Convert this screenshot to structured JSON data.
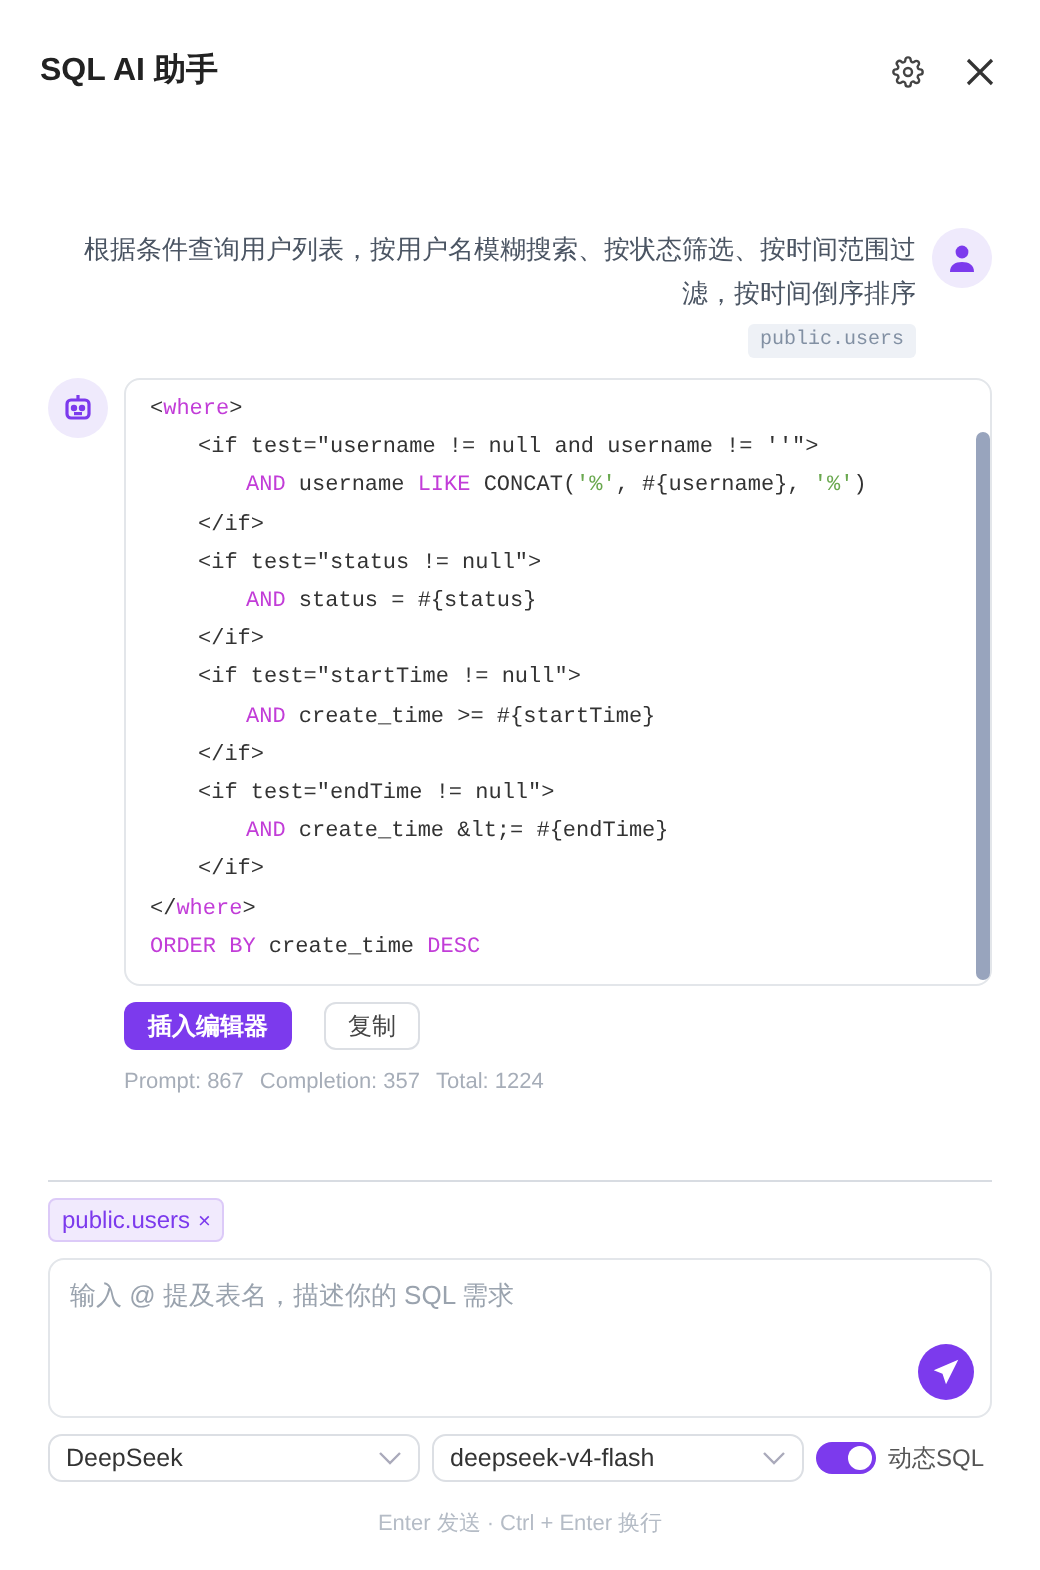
{
  "header": {
    "title": "SQL AI 助手"
  },
  "user_message": {
    "text": "根据条件查询用户列表，按用户名模糊搜索、按状态筛选、按时间范围过滤，按时间倒序排序",
    "table_tag": "public.users"
  },
  "assistant_message": {
    "code_lines": [
      {
        "tokens": [
          {
            "kind": "plain",
            "text": "<"
          },
          {
            "kind": "kw",
            "text": "where"
          },
          {
            "kind": "plain",
            "text": ">"
          }
        ],
        "children": [
          {
            "tokens": [
              {
                "kind": "plain",
                "text": "<if test=\"username != null and username != ''\">"
              }
            ],
            "children": [
              {
                "tokens": [
                  {
                    "kind": "kw",
                    "text": "AND"
                  },
                  {
                    "kind": "plain",
                    "text": " username "
                  },
                  {
                    "kind": "kw",
                    "text": "LIKE"
                  },
                  {
                    "kind": "plain",
                    "text": " CONCAT("
                  },
                  {
                    "kind": "str",
                    "text": "'%'"
                  },
                  {
                    "kind": "plain",
                    "text": ", #{username}, "
                  },
                  {
                    "kind": "str",
                    "text": "'%'"
                  },
                  {
                    "kind": "plain",
                    "text": ")"
                  }
                ]
              }
            ]
          },
          {
            "tokens": [
              {
                "kind": "plain",
                "text": "</if>"
              }
            ]
          },
          {
            "tokens": [
              {
                "kind": "plain",
                "text": "<if test=\"status != null\">"
              }
            ],
            "children": [
              {
                "tokens": [
                  {
                    "kind": "kw",
                    "text": "AND"
                  },
                  {
                    "kind": "plain",
                    "text": " status = #{status}"
                  }
                ]
              }
            ]
          },
          {
            "tokens": [
              {
                "kind": "plain",
                "text": "</if>"
              }
            ]
          },
          {
            "tokens": [
              {
                "kind": "plain",
                "text": "<if test=\"startTime != null\">"
              }
            ],
            "children": [
              {
                "tokens": [
                  {
                    "kind": "kw",
                    "text": "AND"
                  },
                  {
                    "kind": "plain",
                    "text": " create_time >= #{startTime}"
                  }
                ]
              }
            ]
          },
          {
            "tokens": [
              {
                "kind": "plain",
                "text": "</if>"
              }
            ]
          },
          {
            "tokens": [
              {
                "kind": "plain",
                "text": "<if test=\"endTime != null\">"
              }
            ],
            "children": [
              {
                "tokens": [
                  {
                    "kind": "kw",
                    "text": "AND"
                  },
                  {
                    "kind": "plain",
                    "text": " create_time &lt;= #{endTime}"
                  }
                ]
              }
            ]
          },
          {
            "tokens": [
              {
                "kind": "plain",
                "text": "</if>"
              }
            ]
          }
        ]
      },
      {
        "tokens": [
          {
            "kind": "plain",
            "text": "</"
          },
          {
            "kind": "kw",
            "text": "where"
          },
          {
            "kind": "plain",
            "text": ">"
          }
        ]
      },
      {
        "tokens": [
          {
            "kind": "kw",
            "text": "ORDER BY"
          },
          {
            "kind": "plain",
            "text": " create_time "
          },
          {
            "kind": "kw",
            "text": "DESC"
          }
        ]
      }
    ],
    "buttons": [
      {
        "kind": "primary",
        "label": "插入编辑器"
      },
      {
        "kind": "outline",
        "label": "复制"
      }
    ],
    "usage": [
      "Prompt: 867",
      "Completion: 357",
      "Total: 1224"
    ]
  },
  "composer": {
    "chips": [
      {
        "label": "public.users",
        "remove": "×"
      }
    ],
    "placeholder": "输入 @ 提及表名，描述你的 SQL 需求"
  },
  "provider_select": "DeepSeek",
  "model_select": "deepseek-v4-flash",
  "dynamic_sql": {
    "label": "动态SQL",
    "on": true
  },
  "hint": "Enter 发送 · Ctrl + Enter 换行"
}
